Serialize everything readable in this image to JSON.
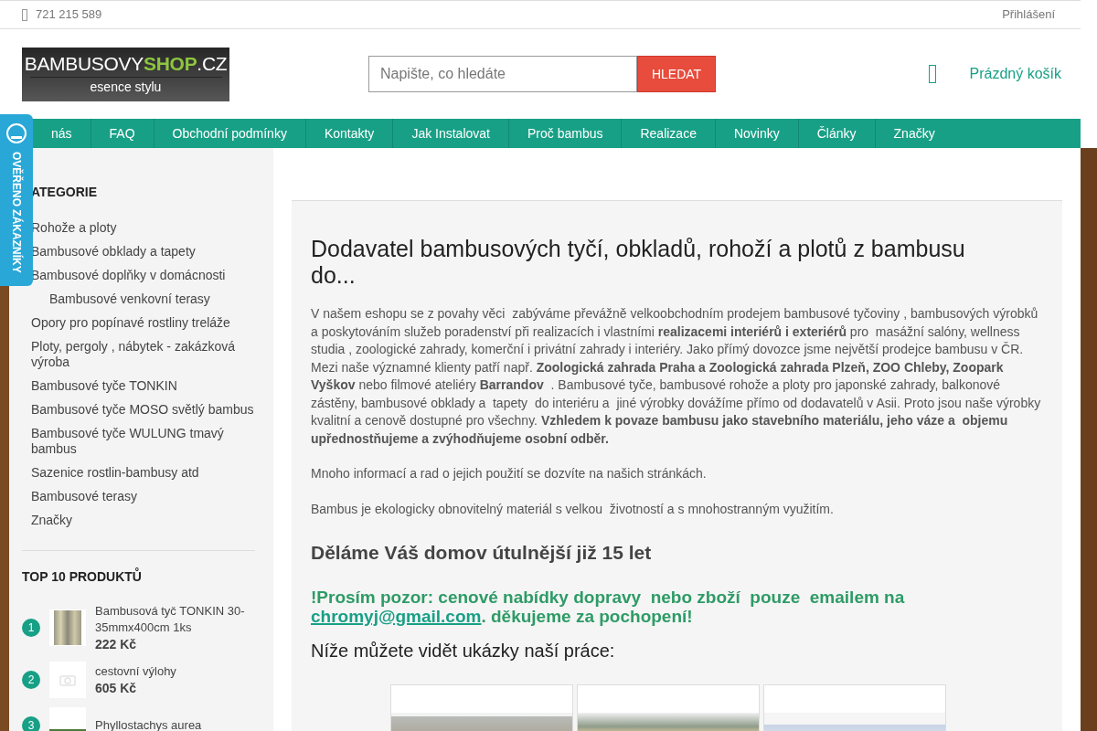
{
  "top_bar": {
    "phone": "721 215 589",
    "login": "Přihlášení"
  },
  "logo": {
    "brand": "BAMBUSOVY",
    "brand_highlight": "SHOP",
    "brand_suffix": ".CZ",
    "tagline": "esence stylu"
  },
  "search": {
    "placeholder": "Napište, co hledáte",
    "button": "HLEDAT"
  },
  "cart": {
    "label": "Prázdný košík"
  },
  "nav": [
    "nás",
    "FAQ",
    "Obchodní podmínky",
    "Kontakty",
    "Jak Instalovat",
    "Proč bambus",
    "Realizace",
    "Novinky",
    "Články",
    "Značky"
  ],
  "badge": {
    "label": "OVĚŘENO ZÁKAZNÍKY"
  },
  "sidebar": {
    "categories_title": "ATEGORIE",
    "categories": [
      {
        "label": "Rohože a ploty"
      },
      {
        "label": "Bambusové obklady a tapety"
      },
      {
        "label": "Bambusové doplňky v domácnosti",
        "children": [
          {
            "label": "Bambusové venkovní terasy"
          }
        ]
      },
      {
        "label": "Opory pro popínavé rostliny treláže"
      },
      {
        "label": "Ploty, pergoly , nábytek - zakázková výroba"
      },
      {
        "label": "Bambusové tyče TONKIN"
      },
      {
        "label": "Bambusové tyče MOSO světlý bambus"
      },
      {
        "label": "Bambusové tyče WULUNG tmavý bambus"
      },
      {
        "label": "Sazenice rostlin-bambusy atd"
      },
      {
        "label": "Bambusové terasy"
      },
      {
        "label": "Značky"
      }
    ],
    "top_title": "TOP 10 PRODUKTŮ",
    "products": [
      {
        "rank": "1",
        "name": "Bambusová tyč TONKIN 30-35mmx400cm 1ks",
        "price": "222 Kč",
        "kind": "canes"
      },
      {
        "rank": "2",
        "name": "cestovní výlohy",
        "price": "605 Kč",
        "kind": "none"
      },
      {
        "rank": "3",
        "name": "Phyllostachys aurea",
        "kind": "plant"
      }
    ]
  },
  "content": {
    "heading": "Dodavatel bambusových tyčí, obkladů, rohoží a plotů z bambusu do...",
    "paragraphs": [
      "V našem eshopu se z povahy věci  zabýváme převážně velkoobchodním prodejem bambusové tyčoviny , bambusových výrobků a poskytováním služeb poradenství při realizacích i vlastními **realizacemi interiérů i exteriérů** pro  masážní salóny, wellness studia , zoologické zahrady, komerční i privátní zahrady i interiéry. Jako přímý dovozce jsme největší prodejce bambusu v ČR. Mezi naše významné klienty patří např. **Zoologická zahrada Praha a Zoologická zahrada Plzeň, ZOO Chleby, Zoopark Vyškov** nebo filmové ateliéry **Barrandov**  . Bambusové tyče, bambusové rohože a ploty pro japonské zahrady, balkonové zástěny, bambusové obklady a  tapety  do interiéru a  jiné výrobky dovážíme přímo od dodavatelů v Asii. Proto jsou naše výrobky kvalitní a cenově dostupné pro všechny. **Vzhledem k povaze bambusu jako stavebního materiálu, jeho váze a  objemu upřednostňujeme a zvýhodňujeme osobní odběr.**",
      "Mnoho informací a rad o jejich použití se dozvíte na našich stránkách.",
      "Bambus je ekologicky obnovitelný materiál s velkou  životností a s mnohostranným využitím."
    ],
    "subheading": "Děláme Váš domov útulnější již 15 let",
    "notice": {
      "before": "!Prosím pozor: cenové nabídky dopravy  nebo zboží  pouze  emailem na ",
      "link": "chromyj@gmail.com",
      "after": ". děkujeme za pochopení!"
    },
    "gallery_title": "Níže můžete vidět ukázky naší práce:",
    "gallery": [
      {
        "kind": "house"
      },
      {
        "kind": "fence"
      },
      {
        "kind": "landscape"
      }
    ]
  }
}
